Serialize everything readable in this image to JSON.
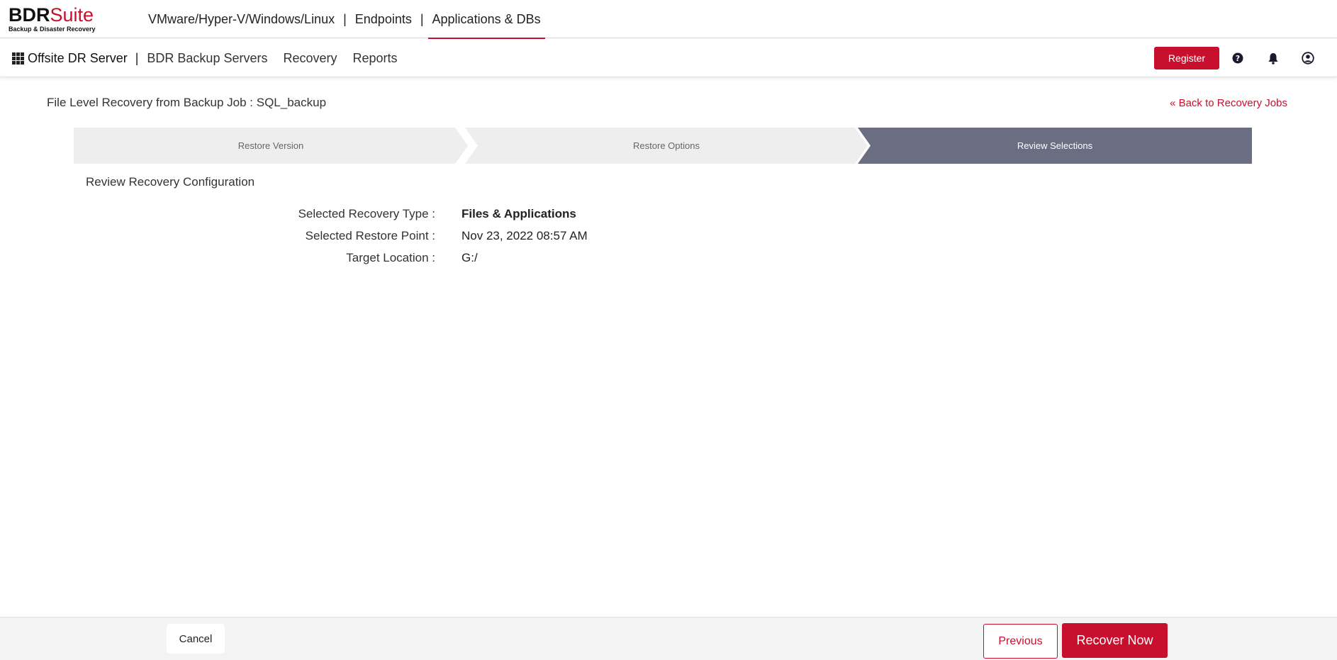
{
  "brand": {
    "name_part1": "BDR",
    "name_part2": "Suite",
    "tagline": "Backup & Disaster Recovery",
    "accent_color": "#c8102e"
  },
  "product_nav": {
    "items": [
      {
        "label": "VMware/Hyper-V/Windows/Linux",
        "active": false
      },
      {
        "label": "Endpoints",
        "active": false
      },
      {
        "label": "Applications & DBs",
        "active": true
      }
    ],
    "separator": "|"
  },
  "sub_nav": {
    "server_label": "Offsite DR Server",
    "separator": "|",
    "links": [
      "BDR Backup Servers",
      "Recovery",
      "Reports"
    ],
    "register_label": "Register",
    "icons": [
      "help-icon",
      "notification-bell-icon",
      "user-account-icon"
    ]
  },
  "page": {
    "title": "File Level Recovery from Backup Job : SQL_backup",
    "back_link": "« Back to Recovery Jobs"
  },
  "wizard": {
    "steps": [
      {
        "label": "Restore Version",
        "active": false
      },
      {
        "label": "Restore Options",
        "active": false
      },
      {
        "label": "Review Selections",
        "active": true
      }
    ],
    "active_color": "#6b6d82"
  },
  "review": {
    "section_title": "Review Recovery Configuration",
    "rows": [
      {
        "label": "Selected Recovery Type :",
        "value": "Files & Applications"
      },
      {
        "label": "Selected Restore Point :",
        "value": "Nov 23, 2022 08:57 AM"
      },
      {
        "label": "Target Location :",
        "value": "G:/"
      }
    ]
  },
  "footer": {
    "cancel_label": "Cancel",
    "previous_label": "Previous",
    "recover_label": "Recover Now"
  }
}
